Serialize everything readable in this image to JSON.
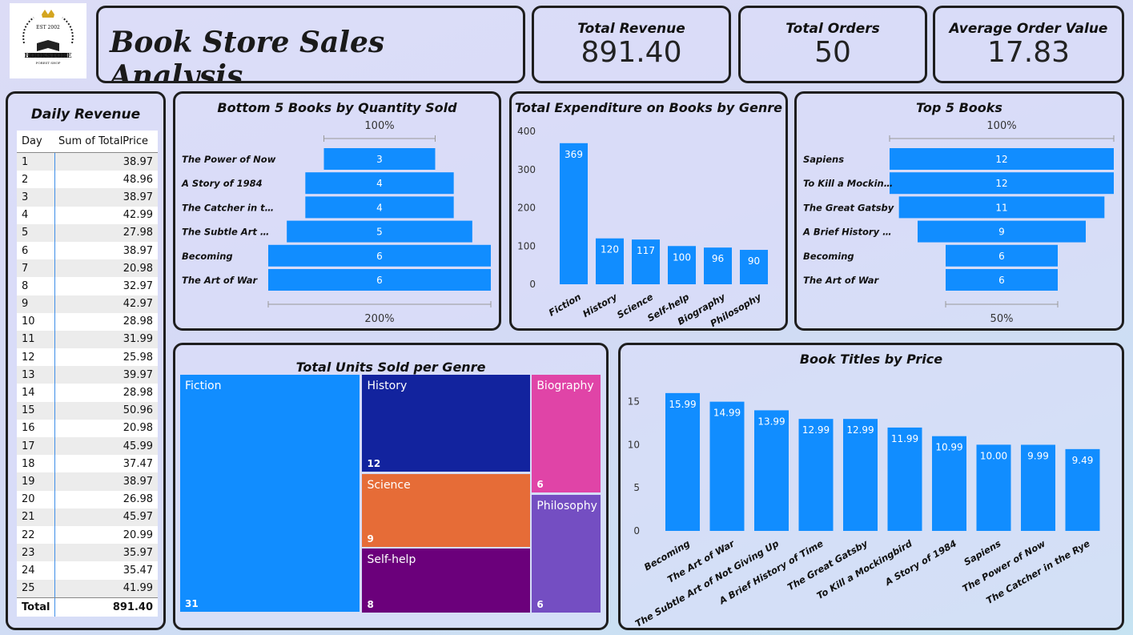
{
  "logo": {
    "est": "EST 2002",
    "name": "BOOKSTORE",
    "sub": "FOREST SHOP"
  },
  "title": "Book Store Sales Analysis",
  "kpis": [
    {
      "label": "Total Revenue",
      "value": "891.40"
    },
    {
      "label": "Total Orders",
      "value": "50"
    },
    {
      "label": "Average Order Value",
      "value": "17.83"
    }
  ],
  "colors": {
    "bar": "#118dff",
    "dark": "#1e1e1e"
  },
  "daily": {
    "title": "Daily Revenue",
    "col1": "Day",
    "col2": "Sum of TotalPrice",
    "rows": [
      [
        "1",
        "38.97"
      ],
      [
        "2",
        "48.96"
      ],
      [
        "3",
        "38.97"
      ],
      [
        "4",
        "42.99"
      ],
      [
        "5",
        "27.98"
      ],
      [
        "6",
        "38.97"
      ],
      [
        "7",
        "20.98"
      ],
      [
        "8",
        "32.97"
      ],
      [
        "9",
        "42.97"
      ],
      [
        "10",
        "28.98"
      ],
      [
        "11",
        "31.99"
      ],
      [
        "12",
        "25.98"
      ],
      [
        "13",
        "39.97"
      ],
      [
        "14",
        "28.98"
      ],
      [
        "15",
        "50.96"
      ],
      [
        "16",
        "20.98"
      ],
      [
        "17",
        "45.99"
      ],
      [
        "18",
        "37.47"
      ],
      [
        "19",
        "38.97"
      ],
      [
        "20",
        "26.98"
      ],
      [
        "21",
        "45.97"
      ],
      [
        "22",
        "20.99"
      ],
      [
        "23",
        "35.97"
      ],
      [
        "24",
        "35.47"
      ],
      [
        "25",
        "41.99"
      ]
    ],
    "total_label": "Total",
    "total_value": "891.40"
  },
  "chart_data": [
    {
      "type": "bar",
      "subtype": "funnel",
      "title": "Bottom 5 Books by Quantity Sold",
      "categories": [
        "The Power of Now",
        "A Story of 1984",
        "The Catcher in t…",
        "The Subtle Art …",
        "Becoming",
        "The Art of War"
      ],
      "values": [
        3,
        4,
        4,
        5,
        6,
        6
      ],
      "top_label": "100%",
      "bottom_label": "200%"
    },
    {
      "type": "bar",
      "title": "Total Expenditure on Books by Genre",
      "categories": [
        "Fiction",
        "History",
        "Science",
        "Self-help",
        "Biography",
        "Philosophy"
      ],
      "values": [
        369,
        120,
        117,
        100,
        96,
        90
      ],
      "ylim": [
        0,
        400
      ],
      "yticks": [
        "0",
        "100",
        "200",
        "300",
        "400"
      ]
    },
    {
      "type": "bar",
      "subtype": "funnel",
      "title": "Top 5 Books",
      "categories": [
        "Sapiens",
        "To Kill a Mockin…",
        "The Great Gatsby",
        "A Brief History …",
        "Becoming",
        "The Art of War"
      ],
      "values": [
        12,
        12,
        11,
        9,
        6,
        6
      ],
      "top_label": "100%",
      "bottom_label": "50%"
    },
    {
      "type": "heatmap",
      "subtype": "treemap",
      "title": "Total Units Sold per Genre",
      "categories": [
        "Fiction",
        "History",
        "Science",
        "Self-help",
        "Biography",
        "Philosophy"
      ],
      "values": [
        31,
        12,
        9,
        8,
        6,
        6
      ]
    },
    {
      "type": "bar",
      "title": "Book Titles by Price",
      "categories": [
        "Becoming",
        "The Art of War",
        "The Subtle Art of Not Giving Up",
        "A Brief History of Time",
        "The Great Gatsby",
        "To Kill a Mockingbird",
        "A Story of 1984",
        "Sapiens",
        "The Power of Now",
        "The Catcher in the Rye"
      ],
      "values": [
        15.99,
        14.99,
        13.99,
        12.99,
        12.99,
        11.99,
        10.99,
        10.0,
        9.99,
        9.49
      ],
      "labels": [
        "15.99",
        "14.99",
        "13.99",
        "12.99",
        "12.99",
        "11.99",
        "10.99",
        "10.00",
        "9.99",
        "9.49"
      ],
      "ylim": [
        0,
        17
      ],
      "yticks": [
        "0",
        "5",
        "10",
        "15"
      ]
    }
  ]
}
